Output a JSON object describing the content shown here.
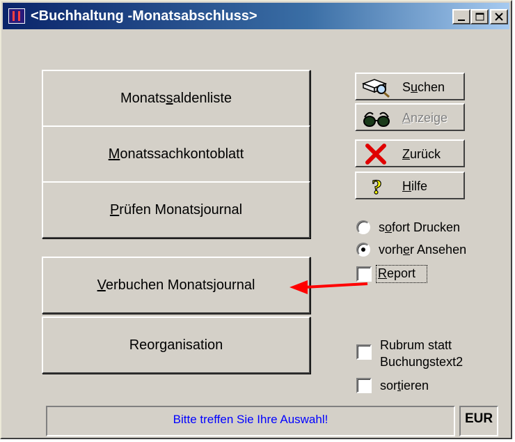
{
  "window": {
    "title": "<Buchhaltung -Monatsabschluss>"
  },
  "main_buttons": [
    {
      "pre": "Monats",
      "u": "s",
      "post": "aldenliste"
    },
    {
      "pre": "",
      "u": "M",
      "post": "onatssachkontoblatt"
    },
    {
      "pre": "",
      "u": "P",
      "post": "rüfen Monatsjournal"
    },
    {
      "pre": "",
      "u": "V",
      "post": "erbuchen Monatsjournal"
    },
    {
      "pre": "Reor",
      "u": "g",
      "post": "anisation"
    }
  ],
  "side_buttons": {
    "suchen": {
      "pre": "S",
      "u": "u",
      "post": "chen",
      "icon": "search-book-icon"
    },
    "anzeige": {
      "pre": "",
      "u": "A",
      "post": "nzeige",
      "icon": "glasses-icon",
      "disabled": true
    },
    "zurueck": {
      "pre": "",
      "u": "Z",
      "post": "urück",
      "icon": "red-x-icon"
    },
    "hilfe": {
      "pre": "",
      "u": "H",
      "post": "ilfe",
      "icon": "question-icon"
    }
  },
  "options": {
    "sofort": {
      "pre": "s",
      "u": "o",
      "post": "fort Drucken",
      "selected": false
    },
    "vorher": {
      "pre": "vorh",
      "u": "e",
      "post": "r Ansehen",
      "selected": true
    },
    "report": {
      "pre": "",
      "u": "R",
      "post": "eport",
      "checked": false
    },
    "rubrum_line1": "Rubrum statt",
    "rubrum_line2": "Buchungstext2",
    "rubrum_checked": false,
    "sortieren": {
      "pre": "sor",
      "u": "t",
      "post": "ieren",
      "checked": false
    }
  },
  "status": {
    "message": "Bitte treffen Sie Ihre Auswahl!",
    "currency": "EUR"
  },
  "colors": {
    "title_start": "#0a246a",
    "title_end": "#a6caf0",
    "status_text": "#0000ff",
    "arrow": "#ff0000"
  }
}
